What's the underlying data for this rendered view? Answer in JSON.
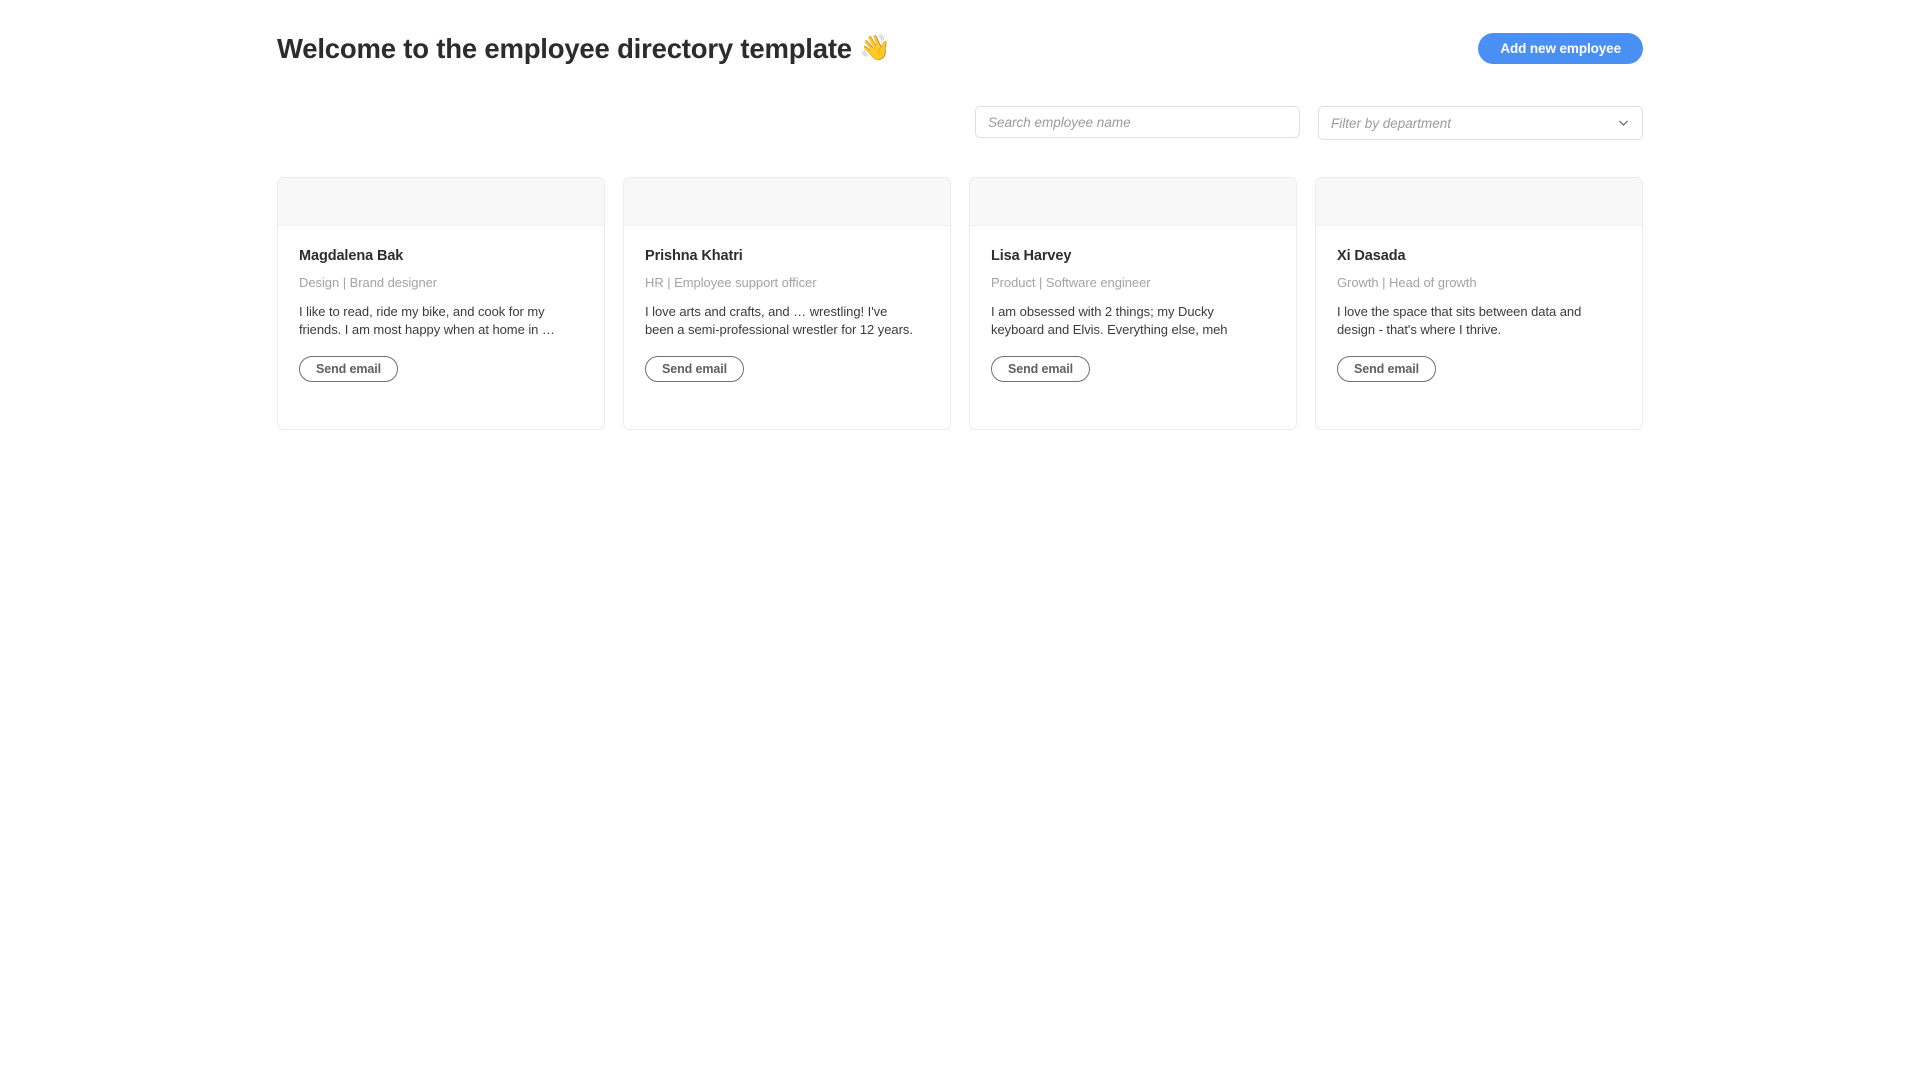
{
  "header": {
    "title": "Welcome to the employee directory template",
    "emoji": "👋",
    "add_employee_label": "Add new employee",
    "accent_color": "#4a90f4"
  },
  "filters": {
    "search_placeholder": "Search employee name",
    "search_value": "",
    "department_placeholder": "Filter by department",
    "department_value": "Filter by department",
    "chevron_icon": "chevron-down-icon"
  },
  "cards": [
    {
      "name": "Magdalena Bak",
      "role": "Design | Brand designer",
      "bio": "I like to read, ride my bike, and cook for my friends. I am most happy when at home in …",
      "button_label": "Send email"
    },
    {
      "name": "Prishna Khatri",
      "role": "HR | Employee support officer",
      "bio": "I love arts and crafts, and … wrestling! I've been a semi-professional wrestler for 12 years.",
      "button_label": "Send email"
    },
    {
      "name": "Lisa Harvey",
      "role": "Product | Software engineer",
      "bio": "I am obsessed with 2 things; my Ducky keyboard and Elvis. Everything else, meh",
      "button_label": "Send email"
    },
    {
      "name": "Xi Dasada",
      "role": "Growth | Head of growth",
      "bio": "I love the space that sits between data and design - that's where I thrive.",
      "button_label": "Send email"
    }
  ]
}
